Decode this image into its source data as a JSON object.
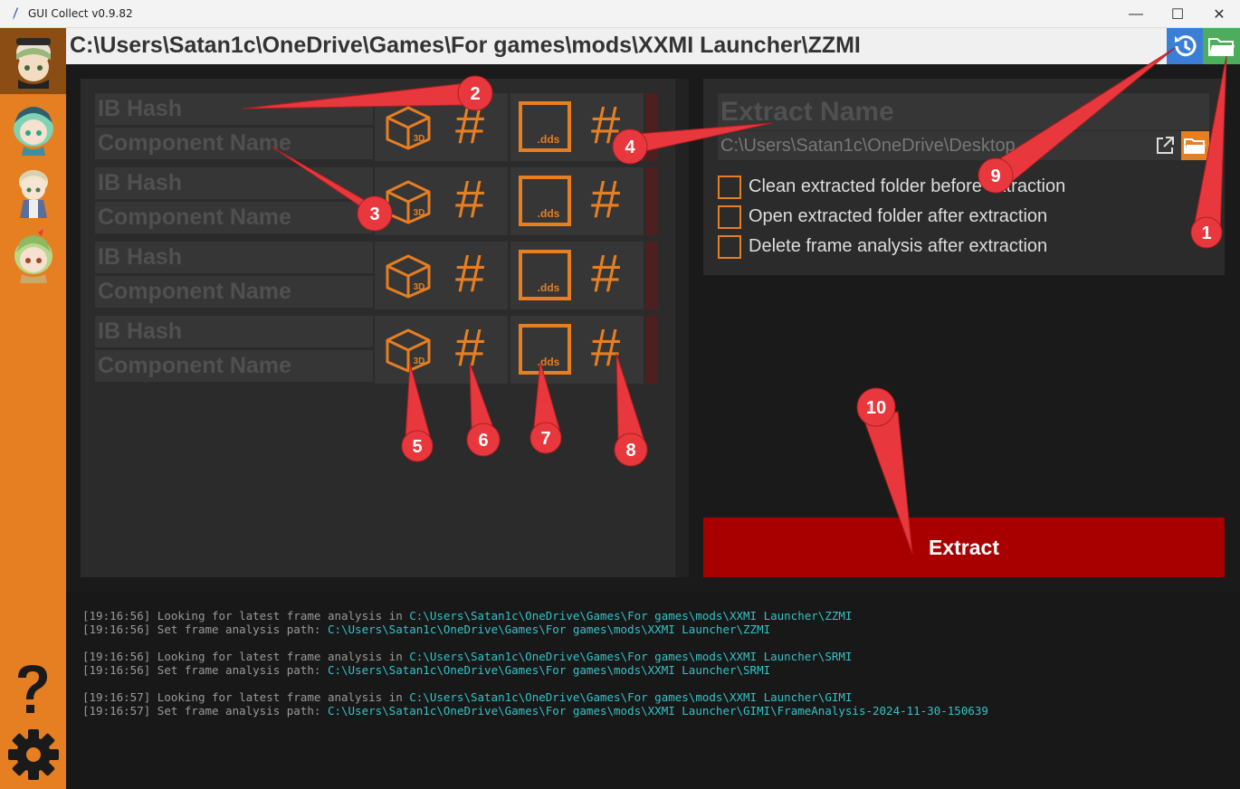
{
  "window": {
    "title": "GUI Collect v0.9.82",
    "minimize_label": "—",
    "maximize_label": "☐",
    "close_label": "✕"
  },
  "colors": {
    "accent": "#e67e22",
    "extract_button": "#a80000",
    "log_path": "#33c3c8",
    "history_button": "#3a7ed8",
    "folder_button": "#4cae5c",
    "annotation": "#e8383d"
  },
  "path_bar": {
    "path": "C:\\Users\\Satan1c\\OneDrive\\Games\\For games\\mods\\XXMI Launcher\\ZZMI",
    "history_icon": "history-icon",
    "folder_icon": "folder-icon"
  },
  "components": [
    {
      "ib_hash_placeholder": "IB Hash",
      "component_name_placeholder": "Component Name",
      "mesh_icon_label": "3D",
      "texture_icon_label": ".dds",
      "hash_glyph": "#"
    },
    {
      "ib_hash_placeholder": "IB Hash",
      "component_name_placeholder": "Component Name",
      "mesh_icon_label": "3D",
      "texture_icon_label": ".dds",
      "hash_glyph": "#"
    },
    {
      "ib_hash_placeholder": "IB Hash",
      "component_name_placeholder": "Component Name",
      "mesh_icon_label": "3D",
      "texture_icon_label": ".dds",
      "hash_glyph": "#"
    },
    {
      "ib_hash_placeholder": "IB Hash",
      "component_name_placeholder": "Component Name",
      "mesh_icon_label": "3D",
      "texture_icon_label": ".dds",
      "hash_glyph": "#"
    }
  ],
  "extract_panel": {
    "extract_name_placeholder": "Extract Name",
    "output_dir": "C:\\Users\\Satan1c\\OneDrive\\Desktop",
    "options": [
      {
        "label": "Clean extracted folder before extraction",
        "checked": false
      },
      {
        "label": "Open extracted folder after extraction",
        "checked": false
      },
      {
        "label": "Delete frame analysis after extraction",
        "checked": false
      }
    ],
    "extract_label": "Extract"
  },
  "sidebar": {
    "characters": [
      "character-avatar-1",
      "character-avatar-2",
      "character-avatar-3",
      "character-avatar-4"
    ],
    "help_glyph": "?",
    "settings_icon": "gear-icon"
  },
  "log": [
    {
      "time": "[19:16:56]",
      "msg": "Looking for latest frame analysis in ",
      "path": "C:\\Users\\Satan1c\\OneDrive\\Games\\For games\\mods\\XXMI Launcher\\ZZMI"
    },
    {
      "time": "[19:16:56]",
      "msg": "Set frame analysis path: ",
      "path": "C:\\Users\\Satan1c\\OneDrive\\Games\\For games\\mods\\XXMI Launcher\\ZZMI"
    },
    {
      "time": "[19:16:56]",
      "msg": "Looking for latest frame analysis in ",
      "path": "C:\\Users\\Satan1c\\OneDrive\\Games\\For games\\mods\\XXMI Launcher\\SRMI"
    },
    {
      "time": "[19:16:56]",
      "msg": "Set frame analysis path: ",
      "path": "C:\\Users\\Satan1c\\OneDrive\\Games\\For games\\mods\\XXMI Launcher\\SRMI"
    },
    {
      "time": "[19:16:57]",
      "msg": "Looking for latest frame analysis in ",
      "path": "C:\\Users\\Satan1c\\OneDrive\\Games\\For games\\mods\\XXMI Launcher\\GIMI"
    },
    {
      "time": "[19:16:57]",
      "msg": "Set frame analysis path: ",
      "path": "C:\\Users\\Satan1c\\OneDrive\\Games\\For games\\mods\\XXMI Launcher\\GIMI\\FrameAnalysis-2024-11-30-150639"
    }
  ],
  "annotations": [
    "1",
    "2",
    "3",
    "4",
    "5",
    "6",
    "7",
    "8",
    "9",
    "10"
  ]
}
